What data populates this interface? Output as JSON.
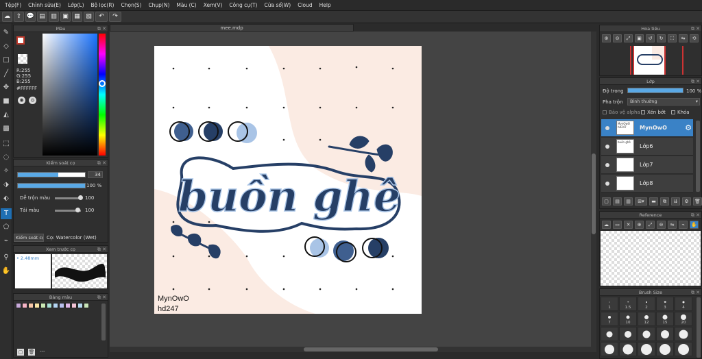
{
  "menu": [
    "Tệp(F)",
    "Chỉnh sửa(E)",
    "Lớp(L)",
    "Bộ lọc(R)",
    "Chọn(S)",
    "Chụp(N)",
    "Màu (C)",
    "Xem(V)",
    "Công cụ(T)",
    "Cửa sổ(W)",
    "Cloud",
    "Help"
  ],
  "document": {
    "tab_title": "mee.mdp"
  },
  "color_panel": {
    "title": "Màu",
    "rgb": {
      "r": "R:255",
      "g": "G:255",
      "b": "B:255"
    },
    "hex": "#FFFFFF"
  },
  "brush_control": {
    "title": "Kiểm soát cọ",
    "size_value": "34",
    "opacity_value": "100 %",
    "blend_label": "Dễ trộn màu",
    "blend_value": "100",
    "amount_label": "Tải màu",
    "amount_value": "100",
    "tab_label": "Kiểm soát cọ",
    "brush_name": "Cọ: Watercolor (Wet)"
  },
  "brush_preview": {
    "title": "Xem trước cọ",
    "size_text": "2.48mm"
  },
  "palette": {
    "title": "Bảng màu",
    "colors": [
      "#c7a9d9",
      "#f5b3c4",
      "#f7c8a8",
      "#f9e5a5",
      "#c9e7b3",
      "#a9e0d6",
      "#b3d4f2",
      "#b9c0ee",
      "#e0b8e8",
      "#f2c2d4",
      "#b6d9f0",
      "#c8e4b8"
    ],
    "more": "---"
  },
  "navigator": {
    "title": "Hoa tiêu"
  },
  "layer_panel": {
    "title": "Lớp",
    "opacity_label": "Độ trong",
    "opacity_value": "100 %",
    "blend_label": "Pha trộn",
    "blend_value": "Bình thường",
    "protect_alpha": "Bảo vệ alpha",
    "clipping": "Xén bớt",
    "lock": "Khóa",
    "layers": [
      {
        "name": "MynOwO",
        "thumb": "MynOwO hd247",
        "selected": true
      },
      {
        "name": "Lớp6",
        "thumb": "buồn ghê",
        "selected": false
      },
      {
        "name": "Lớp7",
        "thumb": "",
        "selected": false
      },
      {
        "name": "Lớp8",
        "thumb": "",
        "selected": false
      }
    ]
  },
  "reference": {
    "title": "Reference"
  },
  "brush_size": {
    "title": "Brush Size",
    "labels": [
      "1",
      "1.5",
      "2",
      "3",
      "4",
      "7",
      "10",
      "12",
      "15",
      "20"
    ]
  },
  "artwork": {
    "title_text": "buồn ghê",
    "signature_line1": "MynOwO",
    "signature_line2": "hd247"
  },
  "colors": {
    "accent": "#3a82c6",
    "ink": "#263f66",
    "mid_blue": "#3f5f8f",
    "light_blue": "#a9c4e6",
    "peach": "#fbebe3",
    "canvas_bg": "#444444"
  }
}
